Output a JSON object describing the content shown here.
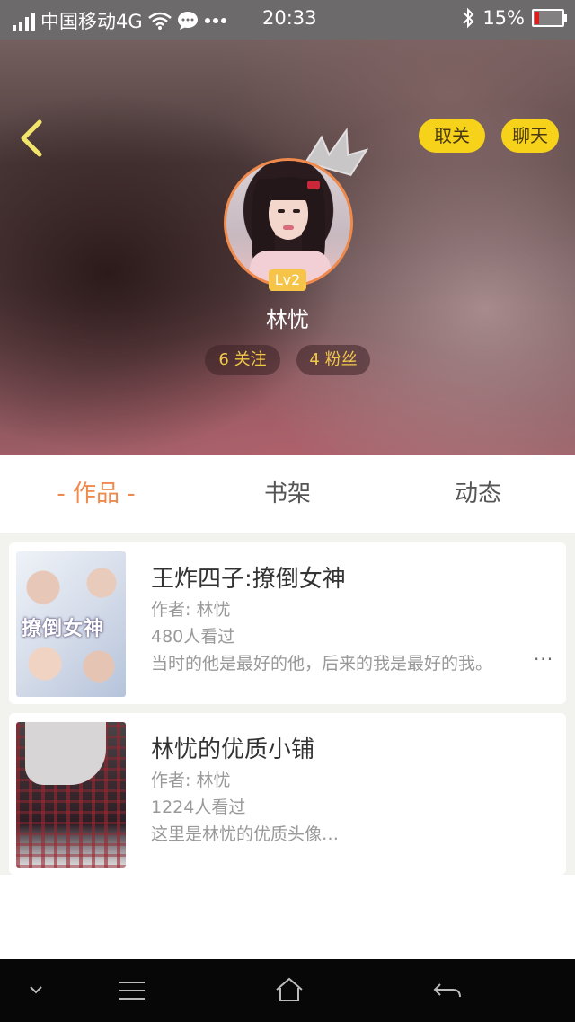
{
  "status_bar": {
    "carrier": "中国移动4G",
    "time": "20:33",
    "battery": "15%",
    "battery_level": 0.15,
    "icons": [
      "signal-icon",
      "wifi-icon",
      "chat-bubble-icon",
      "more-dots-icon",
      "bluetooth-icon",
      "battery-icon"
    ]
  },
  "profile": {
    "back_icon": "chevron-left-icon",
    "unfollow_label": "取关",
    "chat_label": "聊天",
    "level": "Lv2",
    "name": "林忧",
    "following": "6 关注",
    "fans": "4 粉丝",
    "accent_color": "#f6d21a"
  },
  "tabs": {
    "works": "作品",
    "bookshelf": "书架",
    "feed": "动态",
    "active": "works",
    "active_color": "#f08a4c"
  },
  "works": [
    {
      "title": "王炸四子:撩倒女神",
      "author": "作者: 林忧",
      "views": "480人看过",
      "desc": "当时的他是最好的他，后来的我是最好的我。",
      "cover_text": "撩倒女神"
    },
    {
      "title": "林忧的优质小铺",
      "author": "作者: 林忧",
      "views": "1224人看过",
      "desc": "这里是林忧的优质头像…"
    }
  ],
  "more_label": "···",
  "nav_bar": {
    "icons": [
      "chevron-down-icon",
      "menu-icon",
      "home-icon",
      "back-arrow-icon"
    ]
  }
}
